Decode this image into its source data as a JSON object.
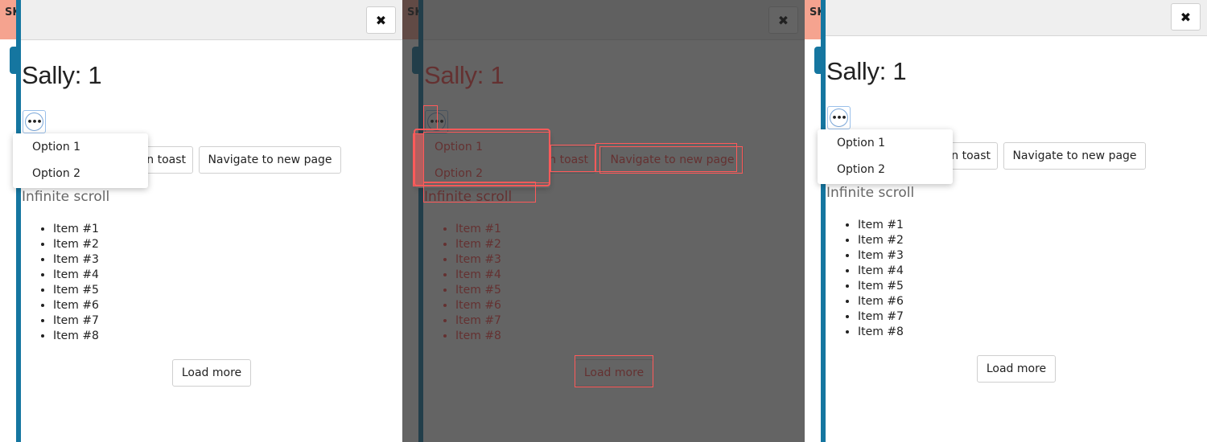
{
  "background": {
    "letters": "SK"
  },
  "modal": {
    "close_symbol": "✖",
    "title": "Sally: 1",
    "more_symbol": "•••",
    "toast_button": "n toast",
    "navigate_button": "Navigate to new page",
    "menu": [
      "Option 1",
      "Option 2"
    ],
    "subtitle": "Infinite scroll",
    "items": [
      "Item #1",
      "Item #2",
      "Item #3",
      "Item #4",
      "Item #5",
      "Item #6",
      "Item #7",
      "Item #8"
    ],
    "load_more": "Load more"
  },
  "colors": {
    "accent": "#1576a0",
    "highlight": "#ff5a5a",
    "overlay": "#666666",
    "background_tab": "#f5a38f"
  }
}
